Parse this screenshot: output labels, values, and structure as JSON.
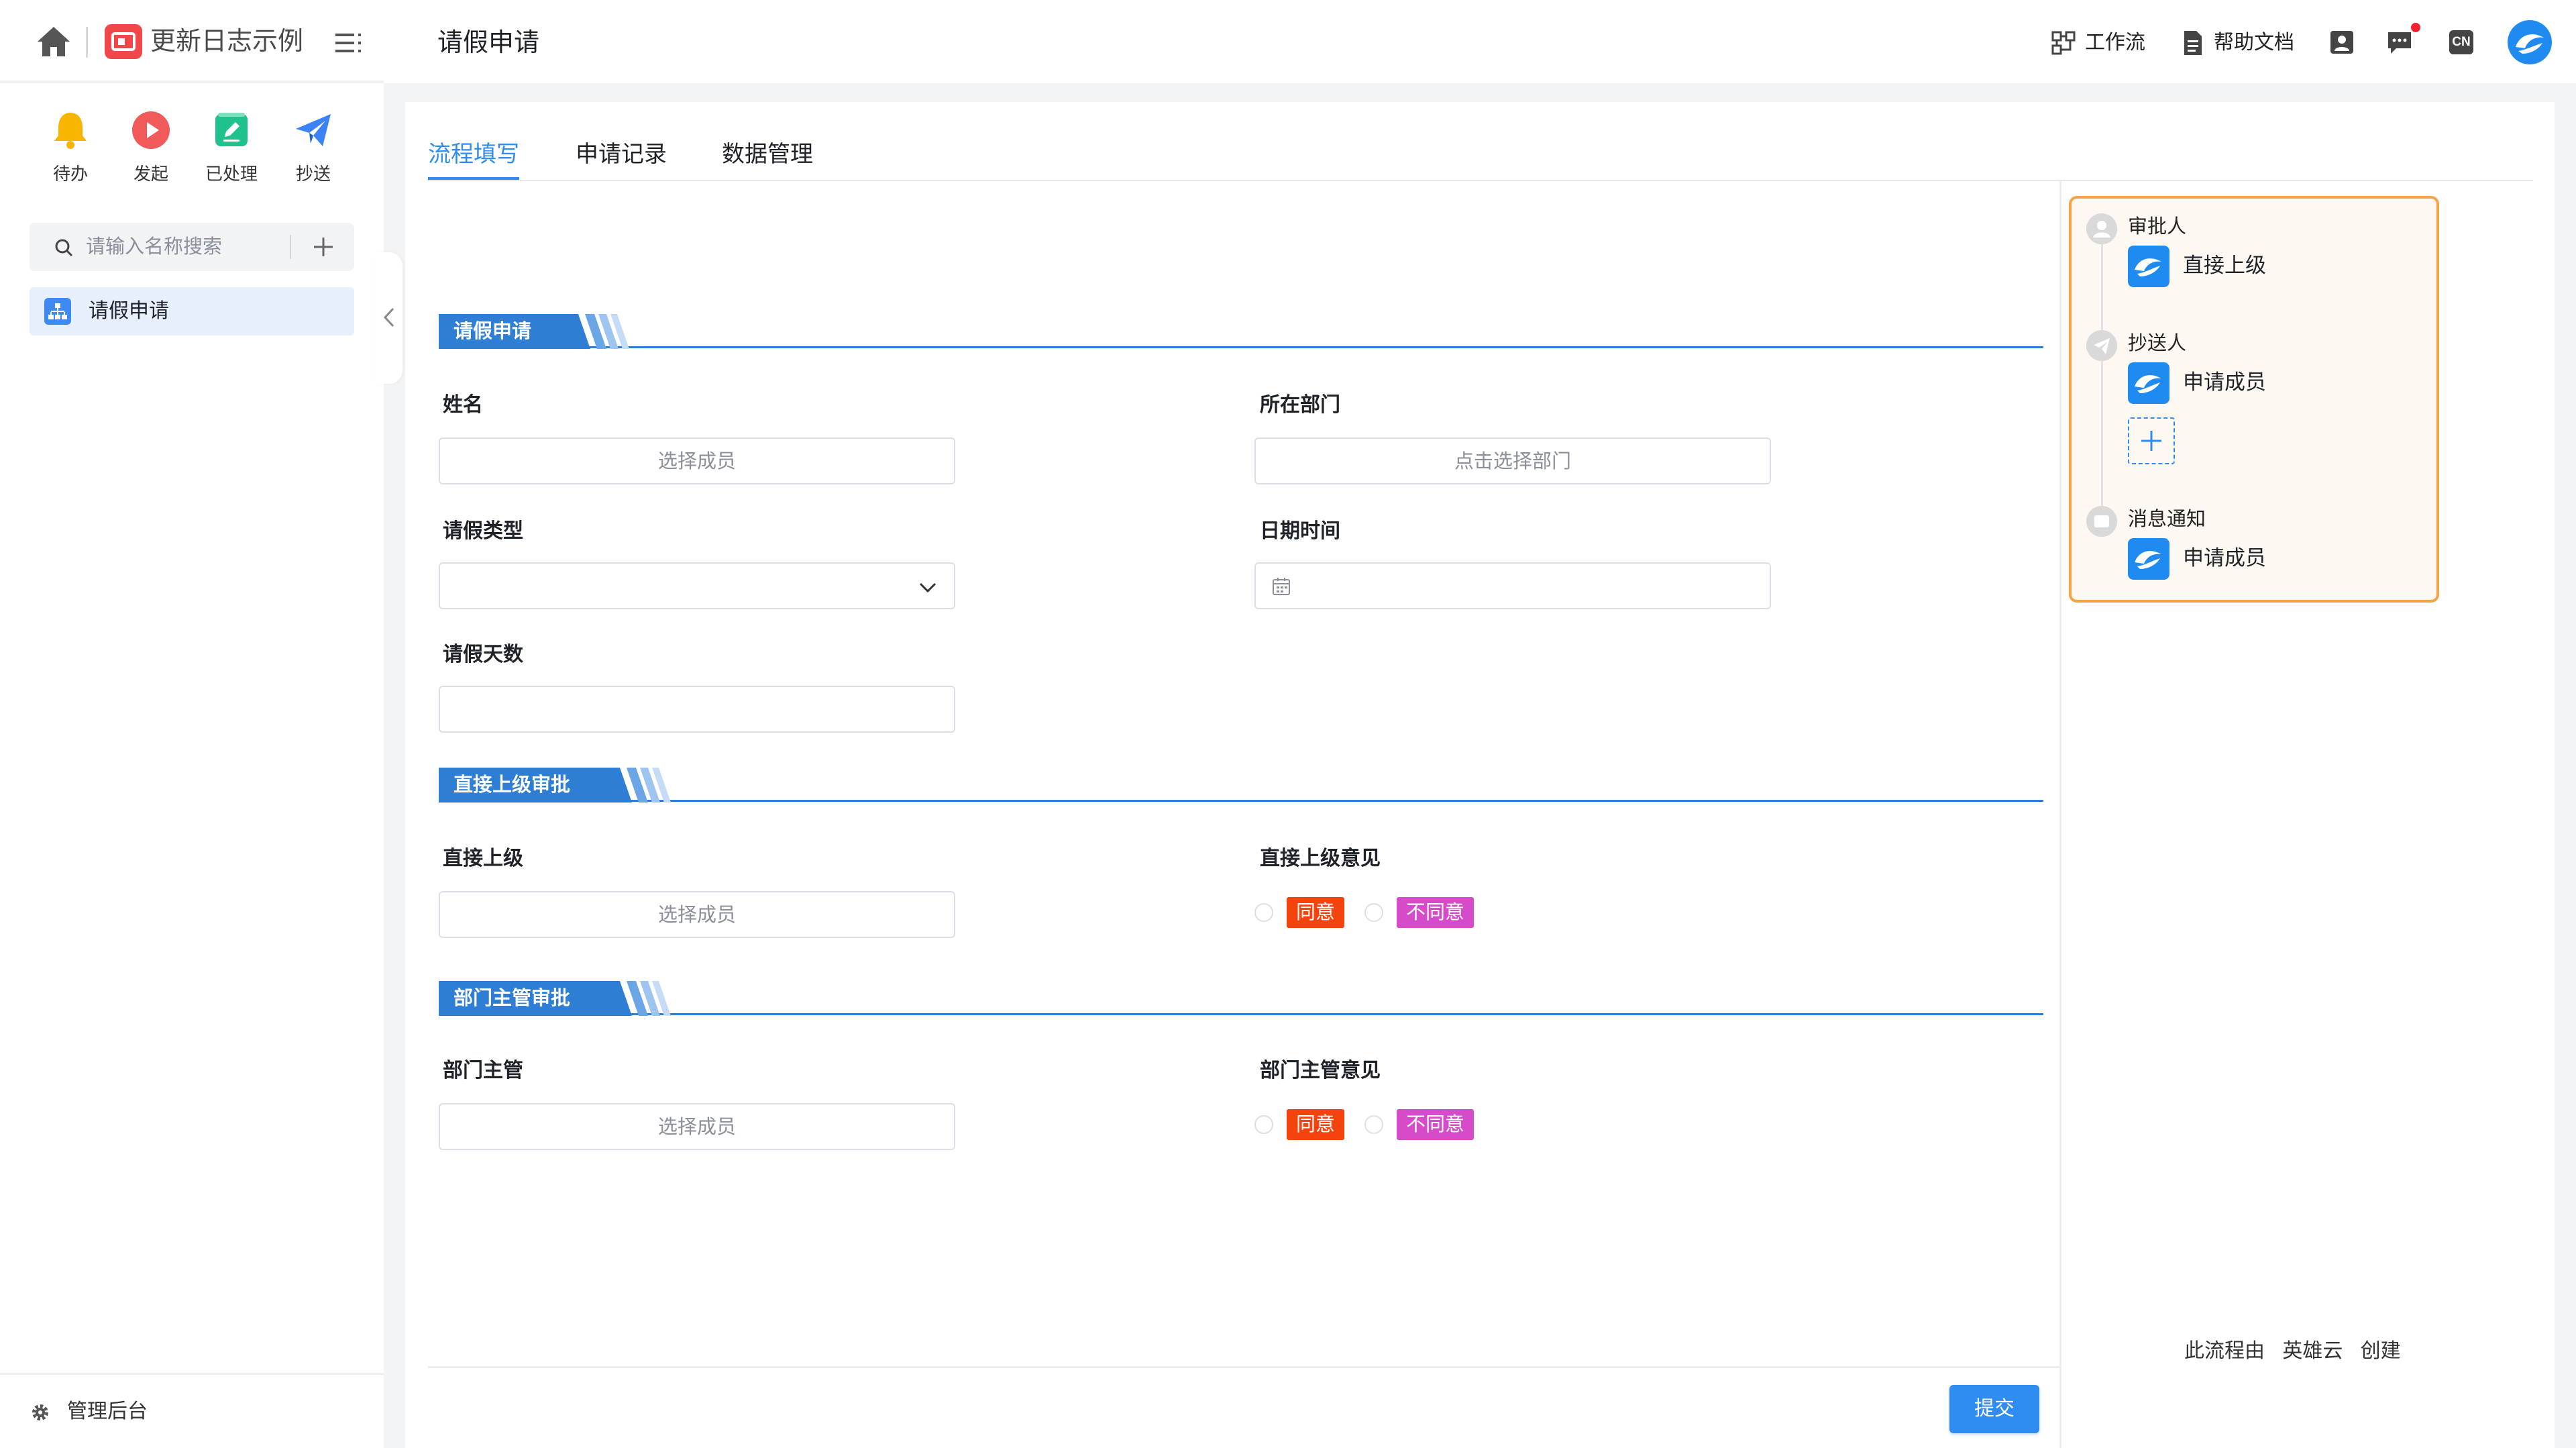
{
  "sidebar": {
    "app_name": "更新日志示例",
    "quick_actions": [
      {
        "label": "待办",
        "icon": "bell-icon"
      },
      {
        "label": "发起",
        "icon": "play-icon"
      },
      {
        "label": "已处理",
        "icon": "edit-icon"
      },
      {
        "label": "抄送",
        "icon": "paper-plane-icon"
      }
    ],
    "search_placeholder": "请输入名称搜索",
    "items": [
      {
        "label": "请假申请",
        "icon": "org-chart-icon"
      }
    ],
    "admin_label": "管理后台"
  },
  "topbar": {
    "title": "请假申请",
    "workflow_label": "工作流",
    "help_label": "帮助文档",
    "lang_badge": "CN"
  },
  "tabs": [
    {
      "label": "流程填写",
      "active": true
    },
    {
      "label": "申请记录",
      "active": false
    },
    {
      "label": "数据管理",
      "active": false
    }
  ],
  "form": {
    "sections": [
      {
        "title": "请假申请",
        "fields": {
          "name_label": "姓名",
          "name_placeholder": "选择成员",
          "dept_label": "所在部门",
          "dept_placeholder": "点击选择部门",
          "type_label": "请假类型",
          "type_value": "",
          "date_label": "日期时间",
          "days_label": "请假天数",
          "days_value": ""
        }
      },
      {
        "title": "直接上级审批",
        "fields": {
          "superior_label": "直接上级",
          "superior_placeholder": "选择成员",
          "opinion_label": "直接上级意见",
          "agree": "同意",
          "disagree": "不同意"
        }
      },
      {
        "title": "部门主管审批",
        "fields": {
          "manager_label": "部门主管",
          "manager_placeholder": "选择成员",
          "opinion_label": "部门主管意见",
          "agree": "同意",
          "disagree": "不同意"
        }
      }
    ],
    "submit_label": "提交"
  },
  "flow": {
    "nodes": [
      {
        "title": "审批人",
        "member": "直接上级"
      },
      {
        "title": "抄送人",
        "member": "申请成员"
      },
      {
        "title": "消息通知",
        "member": "申请成员"
      }
    ],
    "footer": "此流程由 英雄云 创建"
  },
  "colors": {
    "accent": "#2f8cf0",
    "section_blue": "#2e7ed6",
    "agree_tag": "#f5430e",
    "disagree_tag": "#d54bc9",
    "flow_border": "#f5a344",
    "flow_bg": "#fdf8f1"
  }
}
